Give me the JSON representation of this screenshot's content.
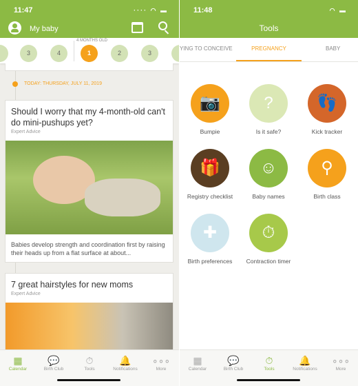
{
  "left": {
    "time": "11:47",
    "header_title": "My baby",
    "age_label": "4 MONTHS OLD",
    "weeks_before": [
      "3",
      "4"
    ],
    "weeks_after": [
      "1",
      "2",
      "3"
    ],
    "today": "TODAY: THURSDAY, JULY 11, 2019",
    "articles": [
      {
        "title": "Should I worry that my 4-month-old can't do mini-pushups yet?",
        "source": "Expert Advice",
        "excerpt": "Babies develop strength and coordination first by raising their heads up from a flat surface at about..."
      },
      {
        "title": "7 great hairstyles for new moms",
        "source": "Expert Advice"
      }
    ]
  },
  "right": {
    "time": "11:48",
    "header_title": "Tools",
    "tabs": [
      "YING TO CONCEIVE",
      "PREGNANCY",
      "BABY"
    ],
    "active_tab": 1,
    "tools": [
      {
        "label": "Bumpie",
        "color": "#f5a11c",
        "icon": "camera-icon"
      },
      {
        "label": "Is it safe?",
        "color": "#dbe8b5",
        "icon": "question-person-icon"
      },
      {
        "label": "Kick tracker",
        "color": "#d4662a",
        "icon": "footprints-icon"
      },
      {
        "label": "Registry checklist",
        "color": "#5a3e22",
        "icon": "gift-icon"
      },
      {
        "label": "Baby names",
        "color": "#8cba44",
        "icon": "baby-id-icon"
      },
      {
        "label": "Birth class",
        "color": "#f5a11c",
        "icon": "teacher-icon"
      },
      {
        "label": "Birth preferences",
        "color": "#cfe6ee",
        "icon": "doctor-icon"
      },
      {
        "label": "Contraction timer",
        "color": "#a7c94a",
        "icon": "stopwatch-icon"
      }
    ]
  },
  "tabbar": [
    {
      "label": "Calendar",
      "icon": "calendar-icon"
    },
    {
      "label": "Birth Club",
      "icon": "chat-bubbles-icon"
    },
    {
      "label": "Tools",
      "icon": "tools-icon"
    },
    {
      "label": "Notifications",
      "icon": "bell-icon"
    },
    {
      "label": "More",
      "icon": "more-icon"
    }
  ],
  "colors": {
    "brand": "#8cba44",
    "accent": "#f5a11c"
  }
}
